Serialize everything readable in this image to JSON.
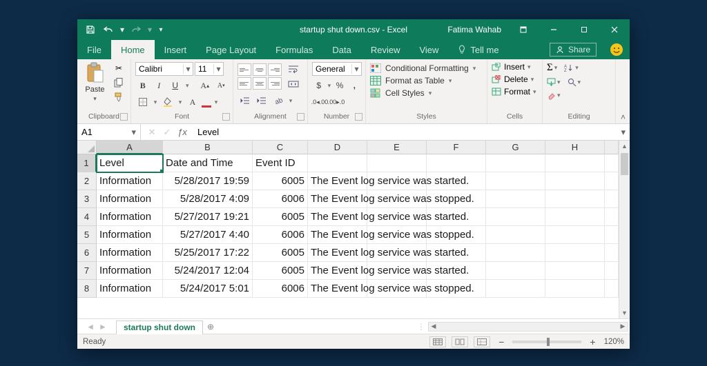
{
  "titlebar": {
    "filename": "startup shut down.csv  -  Excel",
    "user": "Fatima Wahab"
  },
  "ribbon": {
    "tabs": [
      "File",
      "Home",
      "Insert",
      "Page Layout",
      "Formulas",
      "Data",
      "Review",
      "View"
    ],
    "active_index": 1,
    "tellme": "Tell me",
    "share": "Share",
    "groups": {
      "clipboard": {
        "caption": "Clipboard",
        "paste": "Paste"
      },
      "font": {
        "caption": "Font",
        "name": "Calibri",
        "size": "11"
      },
      "alignment": {
        "caption": "Alignment"
      },
      "number": {
        "caption": "Number",
        "format": "General"
      },
      "styles": {
        "caption": "Styles",
        "conditional": "Conditional Formatting",
        "table": "Format as Table",
        "cell": "Cell Styles"
      },
      "cells": {
        "caption": "Cells",
        "insert": "Insert",
        "delete": "Delete",
        "format": "Format"
      },
      "editing": {
        "caption": "Editing"
      }
    }
  },
  "namebox": "A1",
  "formula": "Level",
  "columns": [
    "A",
    "B",
    "C",
    "D",
    "E",
    "F",
    "G",
    "H"
  ],
  "header_row": [
    "Level",
    "Date and Time",
    "Event ID",
    "",
    "",
    "",
    "",
    ""
  ],
  "rows": [
    {
      "a": "Information",
      "b": "5/28/2017 19:59",
      "c": "6005",
      "d": "The Event log service was started."
    },
    {
      "a": "Information",
      "b": "5/28/2017 4:09",
      "c": "6006",
      "d": "The Event log service was stopped."
    },
    {
      "a": "Information",
      "b": "5/27/2017 19:21",
      "c": "6005",
      "d": "The Event log service was started."
    },
    {
      "a": "Information",
      "b": "5/27/2017 4:40",
      "c": "6006",
      "d": "The Event log service was stopped."
    },
    {
      "a": "Information",
      "b": "5/25/2017 17:22",
      "c": "6005",
      "d": "The Event log service was started."
    },
    {
      "a": "Information",
      "b": "5/24/2017 12:04",
      "c": "6005",
      "d": "The Event log service was started."
    },
    {
      "a": "Information",
      "b": "5/24/2017 5:01",
      "c": "6006",
      "d": "The Event log service was stopped."
    }
  ],
  "sheet": {
    "name": "startup shut down"
  },
  "status": {
    "ready": "Ready",
    "zoom": "120%"
  }
}
